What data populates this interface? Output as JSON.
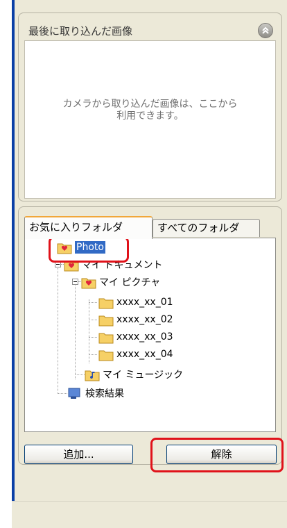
{
  "recent": {
    "title": "最後に取り込んだ画像",
    "message": "カメラから取り込んだ画像は、ここから\n利用できます。"
  },
  "tabs": {
    "favorites": "お気に入りフォルダ",
    "all": "すべてのフォルダ"
  },
  "tree": {
    "photo": "Photo",
    "my_documents": "マイ ドキュメント",
    "my_pictures": "マイ ピクチャ",
    "sub": [
      "xxxx_xx_01",
      "xxxx_xx_02",
      "xxxx_xx_03",
      "xxxx_xx_04"
    ],
    "my_music": "マイ ミュージック",
    "search_results": "検索結果"
  },
  "buttons": {
    "add": "追加...",
    "remove": "解除"
  },
  "colors": {
    "selection": "#316ac5",
    "highlight": "#e0121a",
    "title_bar": "#0a3fa6",
    "panel_bg": "#ece9d8"
  }
}
